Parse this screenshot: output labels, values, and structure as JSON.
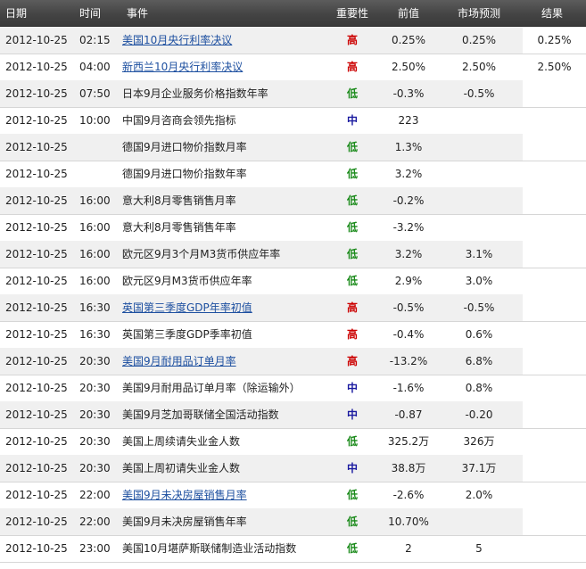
{
  "headers": {
    "date": "日期",
    "time": "时间",
    "event": "事件",
    "importance": "重要性",
    "previous": "前值",
    "forecast": "市场预测",
    "result": "结果"
  },
  "colors": {
    "high": "#cc0000",
    "low": "#1a8a1a",
    "medium": "#1a1aa0",
    "link": "#1e50a0",
    "header_bg": "#444444"
  },
  "rows": [
    {
      "date": "2012-10-25",
      "time": "02:15",
      "event": "美国10月央行利率决议",
      "link": true,
      "importance": "高",
      "level": "high",
      "previous": "0.25%",
      "forecast": "0.25%",
      "result": "0.25%"
    },
    {
      "date": "2012-10-25",
      "time": "04:00",
      "event": "新西兰10月央行利率决议",
      "link": true,
      "importance": "高",
      "level": "high",
      "previous": "2.50%",
      "forecast": "2.50%",
      "result": "2.50%"
    },
    {
      "date": "2012-10-25",
      "time": "07:50",
      "event": "日本9月企业服务价格指数年率",
      "link": false,
      "importance": "低",
      "level": "low",
      "previous": "-0.3%",
      "forecast": "-0.5%",
      "result": ""
    },
    {
      "date": "2012-10-25",
      "time": "10:00",
      "event": "中国9月咨商会领先指标",
      "link": false,
      "importance": "中",
      "level": "medium",
      "previous": "223",
      "forecast": "",
      "result": ""
    },
    {
      "date": "2012-10-25",
      "time": "",
      "event": "德国9月进口物价指数月率",
      "link": false,
      "importance": "低",
      "level": "low",
      "previous": "1.3%",
      "forecast": "",
      "result": ""
    },
    {
      "date": "2012-10-25",
      "time": "",
      "event": "德国9月进口物价指数年率",
      "link": false,
      "importance": "低",
      "level": "low",
      "previous": "3.2%",
      "forecast": "",
      "result": ""
    },
    {
      "date": "2012-10-25",
      "time": "16:00",
      "event": "意大利8月零售销售月率",
      "link": false,
      "importance": "低",
      "level": "low",
      "previous": "-0.2%",
      "forecast": "",
      "result": ""
    },
    {
      "date": "2012-10-25",
      "time": "16:00",
      "event": "意大利8月零售销售年率",
      "link": false,
      "importance": "低",
      "level": "low",
      "previous": "-3.2%",
      "forecast": "",
      "result": ""
    },
    {
      "date": "2012-10-25",
      "time": "16:00",
      "event": "欧元区9月3个月M3货币供应年率",
      "link": false,
      "importance": "低",
      "level": "low",
      "previous": "3.2%",
      "forecast": "3.1%",
      "result": ""
    },
    {
      "date": "2012-10-25",
      "time": "16:00",
      "event": "欧元区9月M3货币供应年率",
      "link": false,
      "importance": "低",
      "level": "low",
      "previous": "2.9%",
      "forecast": "3.0%",
      "result": ""
    },
    {
      "date": "2012-10-25",
      "time": "16:30",
      "event": "英国第三季度GDP年率初值",
      "link": true,
      "importance": "高",
      "level": "high",
      "previous": "-0.5%",
      "forecast": "-0.5%",
      "result": ""
    },
    {
      "date": "2012-10-25",
      "time": "16:30",
      "event": "英国第三季度GDP季率初值",
      "link": false,
      "importance": "高",
      "level": "high",
      "previous": "-0.4%",
      "forecast": "0.6%",
      "result": ""
    },
    {
      "date": "2012-10-25",
      "time": "20:30",
      "event": "美国9月耐用品订单月率",
      "link": true,
      "importance": "高",
      "level": "high",
      "previous": "-13.2%",
      "forecast": "6.8%",
      "result": ""
    },
    {
      "date": "2012-10-25",
      "time": "20:30",
      "event": "美国9月耐用品订单月率（除运输外）",
      "link": false,
      "importance": "中",
      "level": "medium",
      "previous": "-1.6%",
      "forecast": "0.8%",
      "result": ""
    },
    {
      "date": "2012-10-25",
      "time": "20:30",
      "event": "美国9月芝加哥联储全国活动指数",
      "link": false,
      "importance": "中",
      "level": "medium",
      "previous": "-0.87",
      "forecast": "-0.20",
      "result": ""
    },
    {
      "date": "2012-10-25",
      "time": "20:30",
      "event": "美国上周续请失业金人数",
      "link": false,
      "importance": "低",
      "level": "low",
      "previous": "325.2万",
      "forecast": "326万",
      "result": ""
    },
    {
      "date": "2012-10-25",
      "time": "20:30",
      "event": "美国上周初请失业金人数",
      "link": false,
      "importance": "中",
      "level": "medium",
      "previous": "38.8万",
      "forecast": "37.1万",
      "result": ""
    },
    {
      "date": "2012-10-25",
      "time": "22:00",
      "event": "美国9月未决房屋销售月率",
      "link": true,
      "importance": "低",
      "level": "low",
      "previous": "-2.6%",
      "forecast": "2.0%",
      "result": ""
    },
    {
      "date": "2012-10-25",
      "time": "22:00",
      "event": "美国9月未决房屋销售年率",
      "link": false,
      "importance": "低",
      "level": "low",
      "previous": "10.70%",
      "forecast": "",
      "result": ""
    },
    {
      "date": "2012-10-25",
      "time": "23:00",
      "event": "美国10月堪萨斯联储制造业活动指数",
      "link": false,
      "importance": "低",
      "level": "low",
      "previous": "2",
      "forecast": "5",
      "result": ""
    }
  ]
}
